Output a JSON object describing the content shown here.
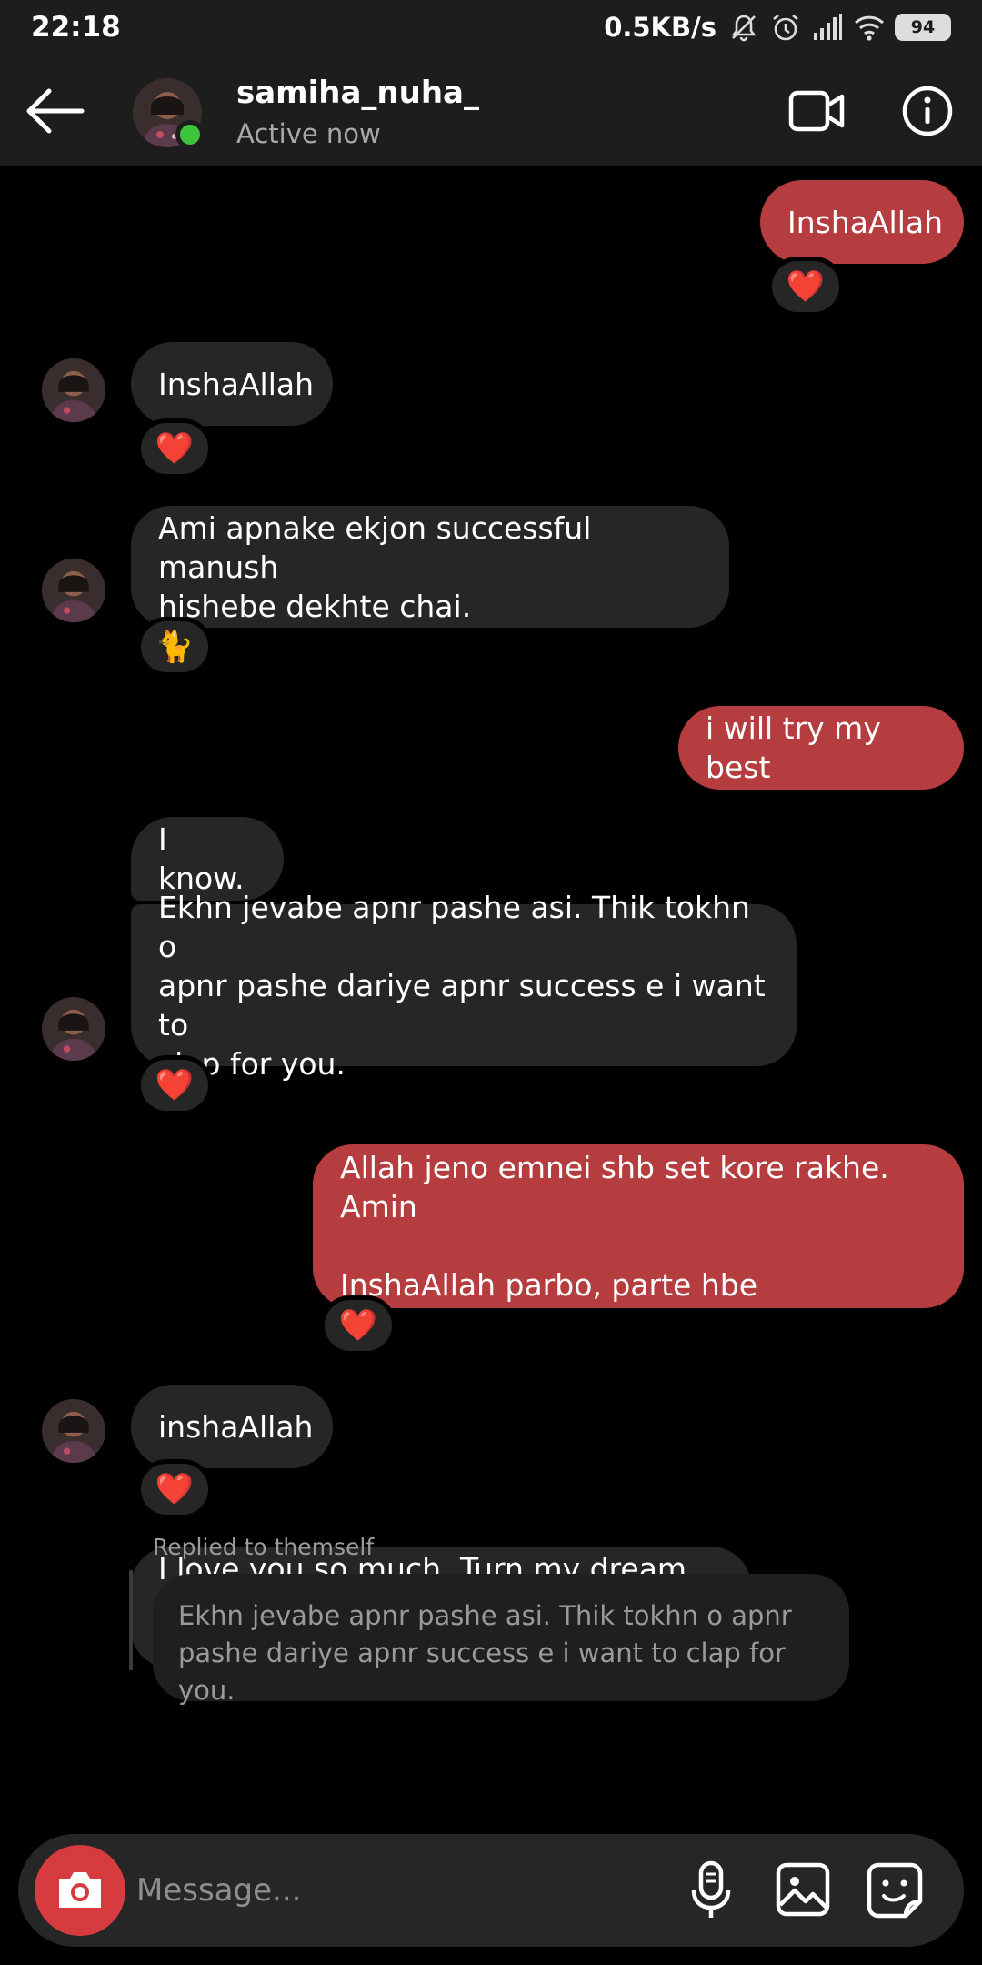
{
  "status_bar": {
    "time": "22:18",
    "net_speed": "0.5KB/s",
    "battery": "94",
    "icons": [
      "bell-muted-icon",
      "alarm-icon",
      "signal-icon",
      "wifi-icon",
      "battery-icon"
    ]
  },
  "header": {
    "username": "samiha_nuha_",
    "status": "Active now",
    "online_color": "#3ec53e"
  },
  "colors": {
    "background": "#000000",
    "incoming_bubble": "#262626",
    "outgoing_bubble": "#b53c3f",
    "bar": "#1d1d1d",
    "camera_button": "#d53b3f"
  },
  "messages": [
    {
      "direction": "out",
      "text": "InshaAllah",
      "reaction": "❤️"
    },
    {
      "direction": "in",
      "text": "InshaAllah",
      "reaction": "❤️"
    },
    {
      "direction": "in",
      "text": "Ami apnake ekjon successful manush\nhishebe dekhte chai.",
      "reaction": "🐈"
    },
    {
      "direction": "out",
      "text": "i will try my best"
    },
    {
      "direction": "in",
      "text": "I know."
    },
    {
      "direction": "in",
      "text": "Ekhn jevabe apnr pashe asi. Thik tokhn o\napnr pashe dariye apnr success e i want to\nclap for you.",
      "reaction": "❤️"
    },
    {
      "direction": "out",
      "text": "Allah jeno emnei shb set kore rakhe. Amin\n\nInshaAllah parbo, parte hbe",
      "reaction": "❤️"
    },
    {
      "direction": "in",
      "text": "inshaAllah",
      "reaction": "❤️"
    },
    {
      "direction": "in",
      "text": "I love you so much. Turn my dream into\nreality"
    }
  ],
  "reply": {
    "label": "Replied to themself",
    "quote": "Ekhn jevabe apnr pashe asi. Thik tokhn o apnr pashe dariye apnr success e i want to clap for you."
  },
  "composer": {
    "placeholder": "Message...",
    "icons": [
      "camera-icon",
      "microphone-icon",
      "gallery-icon",
      "sticker-icon"
    ]
  }
}
